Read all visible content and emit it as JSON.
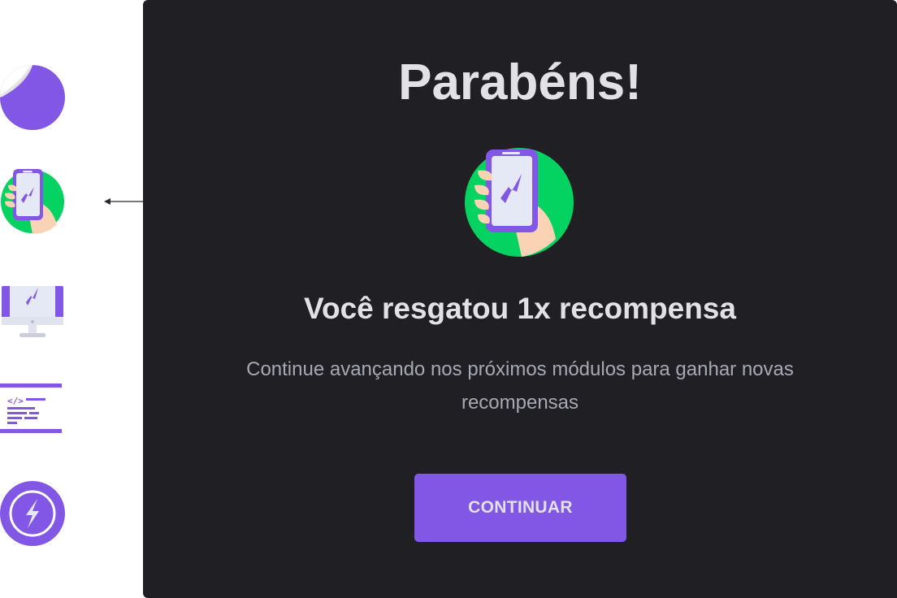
{
  "colors": {
    "modal_background": "#202024",
    "primary_purple": "#8257e5",
    "success_green": "#04d361",
    "title_text": "#e1e1e6",
    "muted_text": "#a8a8b3"
  },
  "rail": {
    "icons": [
      {
        "name": "sticker-icon"
      },
      {
        "name": "phone-reward-icon"
      },
      {
        "name": "monitor-rocket-icon"
      },
      {
        "name": "code-window-icon"
      },
      {
        "name": "lightning-badge-icon"
      }
    ]
  },
  "modal": {
    "title": "Parabéns!",
    "illustration": "phone-reward-icon",
    "heading": "Você resgatou 1x recompensa",
    "description": "Continue avançando nos próximos módulos para ganhar novas recompensas",
    "button_label": "CONTINUAR"
  }
}
